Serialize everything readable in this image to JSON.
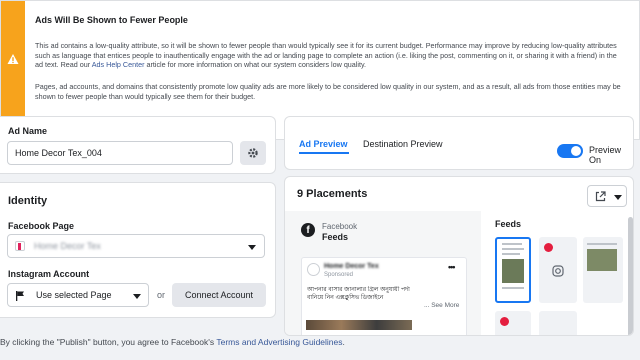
{
  "warning": {
    "title": "Ads Will Be Shown to Fewer People",
    "icon": "warning-icon",
    "para1_a": "This ad contains a low-quality attribute, so it will be shown to fewer people than would typically see it for its current budget. Performance may improve by reducing low-quality attributes such as language that entices people to inauthentically engage with the ad or landing page to complete an action (i.e. liking the post, commenting on it, or sharing it with a friend) in the ad text. Read our ",
    "para1_link": "Ads Help Center",
    "para1_b": " article for more information on what our system considers low quality.",
    "para2": "Pages, ad accounts, and domains that consistently promote low quality ads are more likely to be considered low quality in our system, and as a result, all ads from those entities may be shown to fewer people than would typically see them for their budget.",
    "accent": "#f7a31c"
  },
  "ad_name": {
    "label": "Ad Name",
    "value": "Home Decor Tex_004",
    "settings_icon": "gear-icon"
  },
  "identity": {
    "heading": "Identity",
    "facebook_page_label": "Facebook Page",
    "facebook_page_value": "Home Decor Tex",
    "instagram_label": "Instagram Account",
    "instagram_value": "Use selected Page",
    "or_text": "or",
    "connect_label": "Connect Account"
  },
  "preview": {
    "tabs": [
      "Ad Preview",
      "Destination Preview"
    ],
    "active_tab": "Ad Preview",
    "toggle_label": "Preview On",
    "toggle_on": true,
    "placements_title": "9 Placements",
    "left_platform": "Facebook",
    "left_placement": "Feeds",
    "post_page": "Home Decor Tex",
    "post_sponsored": "Sponsored",
    "post_text": "আপনার বাসার জানালার গ্রিল অনুযায়ী পর্দা বানিয়ে নিন এক্সক্লুসিভ ডিজাইনে",
    "post_see_more": "... See More",
    "right_heading": "Feeds",
    "brand_color": "#1877f2"
  },
  "footer": {
    "text_before": "By clicking the \"Publish\" button, you agree to Facebook's ",
    "link": "Terms and Advertising Guidelines",
    "text_after": "."
  }
}
